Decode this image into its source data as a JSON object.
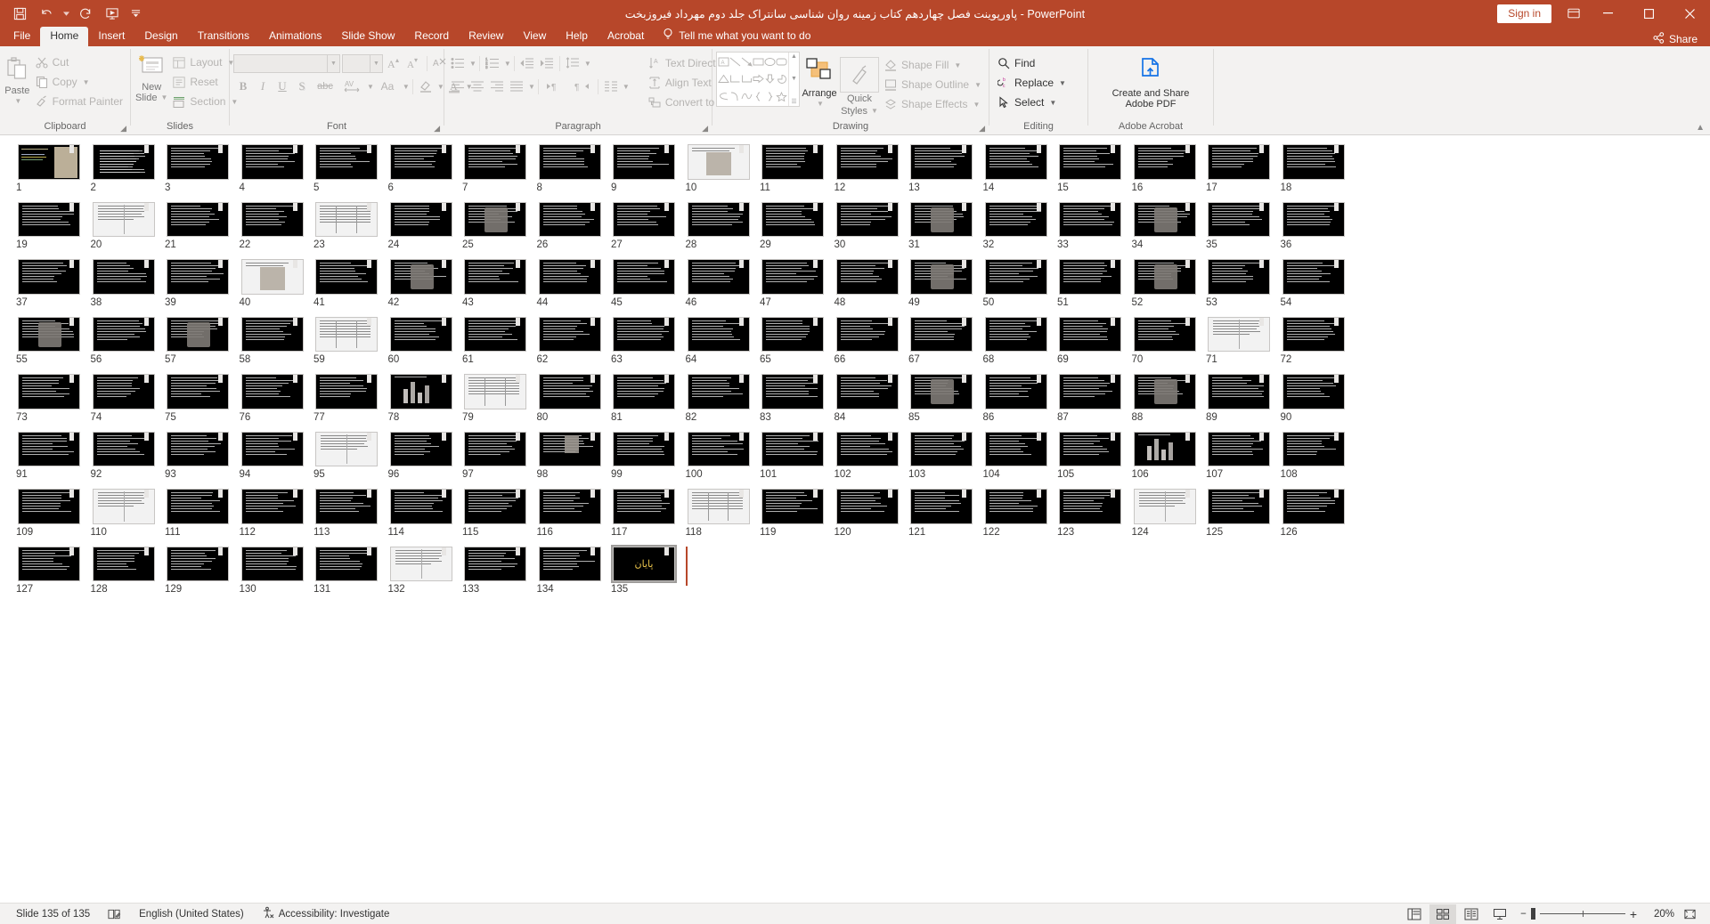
{
  "window": {
    "title_rtl": "پاورپوینت فصل چهاردهم کتاب زمینه روان شناسی سانتراک جلد دوم مهرداد فیروزبخت",
    "app_name": "PowerPoint",
    "separator": "-",
    "sign_in": "Sign in",
    "minimize": "–",
    "maximize": "☐",
    "close": "✕",
    "ribbon_display_icon": "ribbon-display-options-icon"
  },
  "quick_access": [
    {
      "name": "save-icon",
      "label": "Save"
    },
    {
      "name": "undo-icon",
      "label": "Undo"
    },
    {
      "name": "redo-icon",
      "label": "Redo"
    },
    {
      "name": "start-presentation-icon",
      "label": "Start From Beginning"
    },
    {
      "name": "customize-qat-icon",
      "label": "Customize Quick Access Toolbar"
    }
  ],
  "tabs": [
    {
      "label": "File",
      "active": false
    },
    {
      "label": "Home",
      "active": true
    },
    {
      "label": "Insert",
      "active": false
    },
    {
      "label": "Design",
      "active": false
    },
    {
      "label": "Transitions",
      "active": false
    },
    {
      "label": "Animations",
      "active": false
    },
    {
      "label": "Slide Show",
      "active": false
    },
    {
      "label": "Record",
      "active": false
    },
    {
      "label": "Review",
      "active": false
    },
    {
      "label": "View",
      "active": false
    },
    {
      "label": "Help",
      "active": false
    },
    {
      "label": "Acrobat",
      "active": false
    }
  ],
  "tell_me": "Tell me what you want to do",
  "share": "Share",
  "ribbon": {
    "clipboard": {
      "label": "Clipboard",
      "paste": "Paste",
      "cut": "Cut",
      "copy": "Copy",
      "format_painter": "Format Painter"
    },
    "slides": {
      "label": "Slides",
      "new_slide_line1": "New",
      "new_slide_line2": "Slide",
      "layout": "Layout",
      "reset": "Reset",
      "section": "Section"
    },
    "font": {
      "label": "Font",
      "font_name_value": "",
      "font_size_value": "",
      "bold": "B",
      "italic": "I",
      "underline": "U",
      "shadow": "S",
      "strikethrough": "abc",
      "char_spacing": "AV",
      "change_case": "Aa",
      "text_highlight": "text-highlight-icon",
      "font_color": "A",
      "increase_size": "A▴",
      "decrease_size": "A▾",
      "clear_formatting": "clear-formatting-icon"
    },
    "paragraph": {
      "label": "Paragraph",
      "bullets": "bullets-icon",
      "numbering": "numbering-icon",
      "decrease_indent": "decrease-indent-icon",
      "increase_indent": "increase-indent-icon",
      "line_spacing": "line-spacing-icon",
      "align_left": "align-left-icon",
      "align_center": "align-center-icon",
      "align_right": "align-right-icon",
      "justify": "justify-icon",
      "ltr": "left-to-right-icon",
      "rtl": "right-to-left-icon",
      "columns": "columns-icon",
      "text_direction": "Text Direction",
      "align_text": "Align Text",
      "convert_to_smartart": "Convert to SmartArt"
    },
    "drawing": {
      "label": "Drawing",
      "arrange": "Arrange",
      "quick_styles_line1": "Quick",
      "quick_styles_line2": "Styles",
      "shape_fill": "Shape Fill",
      "shape_outline": "Shape Outline",
      "shape_effects": "Shape Effects"
    },
    "editing": {
      "label": "Editing",
      "find": "Find",
      "replace": "Replace",
      "select": "Select"
    },
    "acrobat": {
      "label": "Adobe Acrobat",
      "create_and_share_line1": "Create and Share",
      "create_and_share_line2": "Adobe PDF"
    }
  },
  "sorter": {
    "total_slides": 135,
    "selected_slide": 135,
    "last_slide_text": "پایان",
    "slides": [
      {
        "n": 1,
        "style": "title-image"
      },
      {
        "n": 2,
        "style": "columns"
      },
      {
        "n": 3,
        "style": "text"
      },
      {
        "n": 4,
        "style": "text"
      },
      {
        "n": 5,
        "style": "text"
      },
      {
        "n": 6,
        "style": "text"
      },
      {
        "n": 7,
        "style": "text"
      },
      {
        "n": 8,
        "style": "text"
      },
      {
        "n": 9,
        "style": "text"
      },
      {
        "n": 10,
        "style": "light-image"
      },
      {
        "n": 11,
        "style": "text"
      },
      {
        "n": 12,
        "style": "text"
      },
      {
        "n": 13,
        "style": "text"
      },
      {
        "n": 14,
        "style": "text"
      },
      {
        "n": 15,
        "style": "text"
      },
      {
        "n": 16,
        "style": "text"
      },
      {
        "n": 17,
        "style": "text"
      },
      {
        "n": 18,
        "style": "text"
      },
      {
        "n": 19,
        "style": "text"
      },
      {
        "n": 20,
        "style": "light-doc"
      },
      {
        "n": 21,
        "style": "text"
      },
      {
        "n": 22,
        "style": "text"
      },
      {
        "n": 23,
        "style": "light-table"
      },
      {
        "n": 24,
        "style": "text"
      },
      {
        "n": 25,
        "style": "image"
      },
      {
        "n": 26,
        "style": "text"
      },
      {
        "n": 27,
        "style": "text"
      },
      {
        "n": 28,
        "style": "text"
      },
      {
        "n": 29,
        "style": "text"
      },
      {
        "n": 30,
        "style": "text"
      },
      {
        "n": 31,
        "style": "image"
      },
      {
        "n": 32,
        "style": "text"
      },
      {
        "n": 33,
        "style": "text"
      },
      {
        "n": 34,
        "style": "image"
      },
      {
        "n": 35,
        "style": "text"
      },
      {
        "n": 36,
        "style": "text"
      },
      {
        "n": 37,
        "style": "text"
      },
      {
        "n": 38,
        "style": "text"
      },
      {
        "n": 39,
        "style": "text"
      },
      {
        "n": 40,
        "style": "light-image"
      },
      {
        "n": 41,
        "style": "text"
      },
      {
        "n": 42,
        "style": "image"
      },
      {
        "n": 43,
        "style": "text"
      },
      {
        "n": 44,
        "style": "text"
      },
      {
        "n": 45,
        "style": "text"
      },
      {
        "n": 46,
        "style": "text"
      },
      {
        "n": 47,
        "style": "text"
      },
      {
        "n": 48,
        "style": "text"
      },
      {
        "n": 49,
        "style": "image"
      },
      {
        "n": 50,
        "style": "text"
      },
      {
        "n": 51,
        "style": "text"
      },
      {
        "n": 52,
        "style": "image"
      },
      {
        "n": 53,
        "style": "text"
      },
      {
        "n": 54,
        "style": "text"
      },
      {
        "n": 55,
        "style": "image"
      },
      {
        "n": 56,
        "style": "text"
      },
      {
        "n": 57,
        "style": "image"
      },
      {
        "n": 58,
        "style": "text"
      },
      {
        "n": 59,
        "style": "light-table"
      },
      {
        "n": 60,
        "style": "text"
      },
      {
        "n": 61,
        "style": "text"
      },
      {
        "n": 62,
        "style": "text"
      },
      {
        "n": 63,
        "style": "text"
      },
      {
        "n": 64,
        "style": "text"
      },
      {
        "n": 65,
        "style": "text"
      },
      {
        "n": 66,
        "style": "text"
      },
      {
        "n": 67,
        "style": "text"
      },
      {
        "n": 68,
        "style": "text"
      },
      {
        "n": 69,
        "style": "text"
      },
      {
        "n": 70,
        "style": "text"
      },
      {
        "n": 71,
        "style": "light-doc"
      },
      {
        "n": 72,
        "style": "text"
      },
      {
        "n": 73,
        "style": "text"
      },
      {
        "n": 74,
        "style": "text"
      },
      {
        "n": 75,
        "style": "text"
      },
      {
        "n": 76,
        "style": "text"
      },
      {
        "n": 77,
        "style": "text"
      },
      {
        "n": 78,
        "style": "chart"
      },
      {
        "n": 79,
        "style": "light-table"
      },
      {
        "n": 80,
        "style": "text"
      },
      {
        "n": 81,
        "style": "text"
      },
      {
        "n": 82,
        "style": "text"
      },
      {
        "n": 83,
        "style": "text"
      },
      {
        "n": 84,
        "style": "text"
      },
      {
        "n": 85,
        "style": "image"
      },
      {
        "n": 86,
        "style": "text"
      },
      {
        "n": 87,
        "style": "text"
      },
      {
        "n": 88,
        "style": "image"
      },
      {
        "n": 89,
        "style": "text"
      },
      {
        "n": 90,
        "style": "text"
      },
      {
        "n": 91,
        "style": "text"
      },
      {
        "n": 92,
        "style": "text"
      },
      {
        "n": 93,
        "style": "text"
      },
      {
        "n": 94,
        "style": "text"
      },
      {
        "n": 95,
        "style": "light-doc"
      },
      {
        "n": 96,
        "style": "text"
      },
      {
        "n": 97,
        "style": "text"
      },
      {
        "n": 98,
        "style": "portrait"
      },
      {
        "n": 99,
        "style": "text"
      },
      {
        "n": 100,
        "style": "text"
      },
      {
        "n": 101,
        "style": "text"
      },
      {
        "n": 102,
        "style": "text"
      },
      {
        "n": 103,
        "style": "text"
      },
      {
        "n": 104,
        "style": "text"
      },
      {
        "n": 105,
        "style": "text"
      },
      {
        "n": 106,
        "style": "chart"
      },
      {
        "n": 107,
        "style": "text"
      },
      {
        "n": 108,
        "style": "text"
      },
      {
        "n": 109,
        "style": "text"
      },
      {
        "n": 110,
        "style": "light-doc"
      },
      {
        "n": 111,
        "style": "text"
      },
      {
        "n": 112,
        "style": "text"
      },
      {
        "n": 113,
        "style": "text"
      },
      {
        "n": 114,
        "style": "text"
      },
      {
        "n": 115,
        "style": "text"
      },
      {
        "n": 116,
        "style": "text"
      },
      {
        "n": 117,
        "style": "text"
      },
      {
        "n": 118,
        "style": "light-table"
      },
      {
        "n": 119,
        "style": "text"
      },
      {
        "n": 120,
        "style": "text"
      },
      {
        "n": 121,
        "style": "text"
      },
      {
        "n": 122,
        "style": "text"
      },
      {
        "n": 123,
        "style": "text"
      },
      {
        "n": 124,
        "style": "light-doc"
      },
      {
        "n": 125,
        "style": "text"
      },
      {
        "n": 126,
        "style": "text"
      },
      {
        "n": 127,
        "style": "text"
      },
      {
        "n": 128,
        "style": "text"
      },
      {
        "n": 129,
        "style": "text"
      },
      {
        "n": 130,
        "style": "text"
      },
      {
        "n": 131,
        "style": "text"
      },
      {
        "n": 132,
        "style": "light-doc"
      },
      {
        "n": 133,
        "style": "text"
      },
      {
        "n": 134,
        "style": "text"
      },
      {
        "n": 135,
        "style": "end"
      }
    ]
  },
  "status": {
    "slide_counter": "Slide 135 of 135",
    "notes_icon": "notes-icon",
    "language": "English (United States)",
    "accessibility": "Accessibility: Investigate",
    "views": [
      {
        "name": "normal-view-button",
        "label": "Normal",
        "active": false
      },
      {
        "name": "slide-sorter-view-button",
        "label": "Slide Sorter",
        "active": true
      },
      {
        "name": "reading-view-button",
        "label": "Reading View",
        "active": false
      },
      {
        "name": "slide-show-button",
        "label": "Slide Show",
        "active": false
      }
    ],
    "zoom_out": "−",
    "zoom_in": "+",
    "zoom_level": "20%",
    "fit_slide_icon": "fit-slide-to-window-icon"
  },
  "colors": {
    "accent": "#B7472A",
    "ribbon_bg": "#F3F2F1",
    "thumb_dark": "#000000"
  }
}
